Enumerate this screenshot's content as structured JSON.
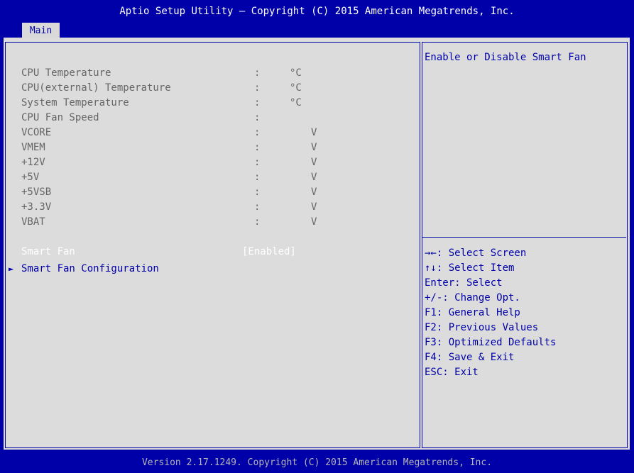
{
  "header": {
    "title": "Aptio Setup Utility – Copyright (C) 2015 American Megatrends, Inc.",
    "tabs": [
      {
        "label": "Main"
      }
    ]
  },
  "monitor": [
    {
      "name": "CPU Temperature",
      "sep": ":",
      "unit": "°C"
    },
    {
      "name": "CPU(external) Temperature",
      "sep": ":",
      "unit": "°C"
    },
    {
      "name": "System Temperature",
      "sep": ":",
      "unit": "°C"
    },
    {
      "name": "CPU Fan Speed",
      "sep": ":",
      "unit": ""
    },
    {
      "name": "VCORE",
      "sep": ":",
      "unit": "V"
    },
    {
      "name": "VMEM",
      "sep": ":",
      "unit": "V"
    },
    {
      "name": "+12V",
      "sep": ":",
      "unit": "V"
    },
    {
      "name": "+5V",
      "sep": ":",
      "unit": "V"
    },
    {
      "name": "+5VSB",
      "sep": ":",
      "unit": "V"
    },
    {
      "name": "+3.3V",
      "sep": ":",
      "unit": "V"
    },
    {
      "name": "VBAT",
      "sep": ":",
      "unit": "V"
    }
  ],
  "settings": {
    "smart_fan": {
      "label": "Smart Fan",
      "value": "[Enabled]"
    },
    "smart_fan_config": {
      "label": "Smart Fan Configuration",
      "arrow": "►"
    }
  },
  "help": {
    "description": "Enable or Disable Smart Fan",
    "keys": [
      "→←: Select Screen",
      "↑↓: Select Item",
      "Enter: Select",
      "+/-: Change Opt.",
      "F1: General Help",
      "F2: Previous Values",
      "F3: Optimized Defaults",
      "F4: Save & Exit",
      "ESC: Exit"
    ]
  },
  "footer": {
    "text": "Version 2.17.1249. Copyright (C) 2015 American Megatrends, Inc."
  },
  "colors": {
    "background": "#0000A8",
    "panel": "#DCDCDC",
    "label_text": "#666666",
    "highlight_text": "#FFFFFF",
    "help_text": "#0000A8"
  }
}
